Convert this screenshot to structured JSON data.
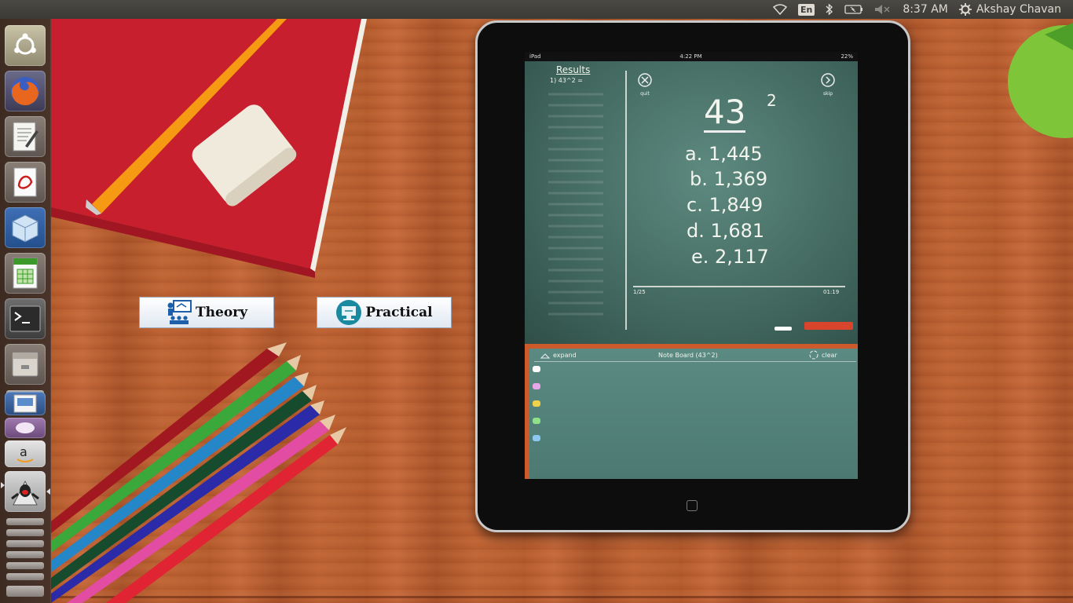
{
  "top_panel": {
    "keyboard_layout": "En",
    "clock": "8:37 AM",
    "user": "Akshay Chavan"
  },
  "launcher": {
    "items": [
      "ubuntu-dash-icon",
      "firefox-icon",
      "text-editor-icon",
      "pdf-viewer-icon",
      "virtualbox-icon",
      "spreadsheet-icon",
      "terminal-icon",
      "files-icon",
      "impress-icon",
      "amazon-icon",
      "java-app-icon"
    ]
  },
  "buttons": {
    "theory": "Theory",
    "practical": "Practical"
  },
  "ipad": {
    "status": {
      "carrier": "iPad",
      "time": "4:22 PM",
      "battery": "22%"
    },
    "results_title": "Results",
    "first_result": "1) 43^2 =",
    "quit": "quit",
    "skip": "skip",
    "question_base": "43",
    "question_exp": "2",
    "options": [
      "a. 1,445",
      "b. 1,369",
      "c. 1,849",
      "d. 1,681",
      "e. 2,117"
    ],
    "progress": "1/25",
    "timer": "01:19",
    "note_expand": "expand",
    "note_title": "Note Board (43^2)",
    "note_clear": "clear"
  }
}
